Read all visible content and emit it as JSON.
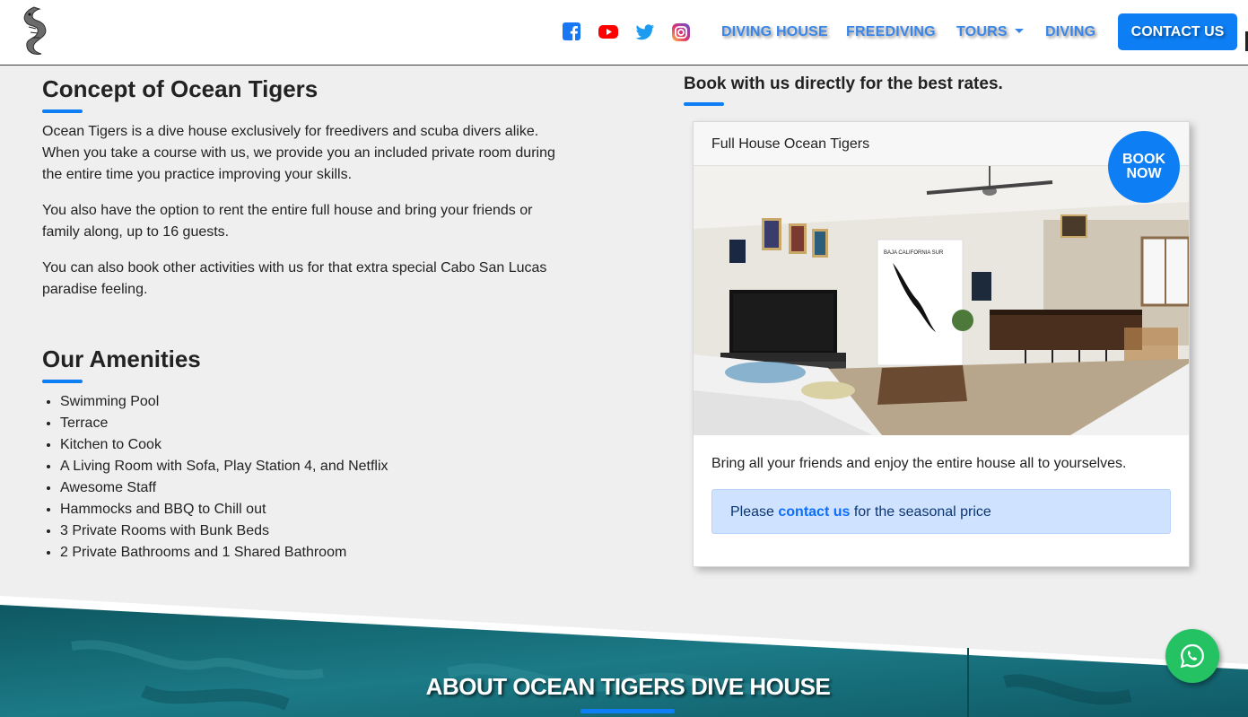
{
  "nav": {
    "logo_icon": "tiger-fish-logo-icon",
    "social": [
      {
        "name": "facebook-icon",
        "color": "#1877f2"
      },
      {
        "name": "youtube-icon",
        "color": "#ff0000"
      },
      {
        "name": "twitter-icon",
        "color": "#1da1f2"
      },
      {
        "name": "instagram-icon",
        "color": "#e1306c"
      }
    ],
    "links": [
      "DIVING HOUSE",
      "FREEDIVING",
      "TOURS",
      "DIVING"
    ],
    "contact_label": "CONTACT US"
  },
  "concept": {
    "title": "Concept of Ocean Tigers",
    "paragraphs": [
      "Ocean Tigers is a dive house exclusively for freedivers and scuba divers alike. When you take a course with us, we provide you an included private room during the entire time you practice improving your skills.",
      "You also have the option to rent the entire full house and bring your friends or family along, up to 16 guests.",
      "You can also book other activities with us for that extra special Cabo San Lucas paradise feeling."
    ]
  },
  "amenities": {
    "title": "Our Amenities",
    "items": [
      "Swimming Pool",
      "Terrace",
      "Kitchen to Cook",
      "A Living Room with Sofa, Play Station 4, and Netflix",
      "Awesome Staff",
      "Hammocks and BBQ to Chill out",
      "3 Private Rooms with Bunk Beds",
      "2 Private Bathrooms and 1 Shared Bathroom"
    ]
  },
  "booking": {
    "heading": "Book with us directly for the best rates.",
    "card_title": "Full House Ocean Tigers",
    "badge_line1": "BOOK",
    "badge_line2": "NOW",
    "map_label": "BAJA CALIFORNIA SUR",
    "description": "Bring all your friends and enjoy the entire house all to yourselves.",
    "alert_prefix": "Please",
    "alert_link": "contact us",
    "alert_suffix": "for the seasonal price"
  },
  "about": {
    "title": "ABOUT OCEAN TIGERS DIVE HOUSE"
  },
  "whatsapp_icon": "whatsapp-icon",
  "colors": {
    "accent": "#0d7ef3",
    "nav_link": "#3a86e8",
    "whatsapp": "#25c263",
    "ocean": "#0f5f6b"
  }
}
